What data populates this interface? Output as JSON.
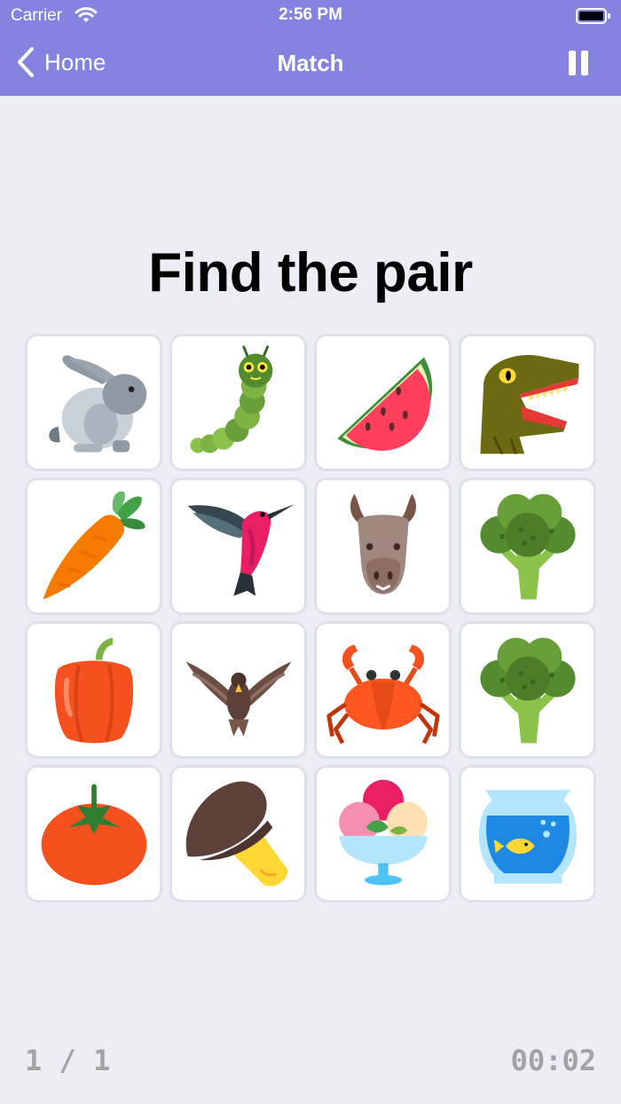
{
  "status_bar": {
    "carrier": "Carrier",
    "time": "2:56 PM"
  },
  "nav": {
    "back_label": "Home",
    "title": "Match"
  },
  "headline": "Find the pair",
  "cards": [
    {
      "icon": "rabbit-icon"
    },
    {
      "icon": "caterpillar-icon"
    },
    {
      "icon": "watermelon-icon"
    },
    {
      "icon": "trex-icon"
    },
    {
      "icon": "carrot-icon"
    },
    {
      "icon": "hummingbird-icon"
    },
    {
      "icon": "llama-icon"
    },
    {
      "icon": "broccoli-icon"
    },
    {
      "icon": "bell-pepper-icon"
    },
    {
      "icon": "eagle-icon"
    },
    {
      "icon": "crab-icon"
    },
    {
      "icon": "broccoli-icon"
    },
    {
      "icon": "tomato-icon"
    },
    {
      "icon": "mushroom-icon"
    },
    {
      "icon": "ice-cream-icon"
    },
    {
      "icon": "fishbowl-icon"
    }
  ],
  "footer": {
    "progress": "1 / 1",
    "timer": "00:02"
  },
  "colors": {
    "header": "#8483df",
    "background": "#eceef6",
    "card_border": "#dfe1ea"
  }
}
